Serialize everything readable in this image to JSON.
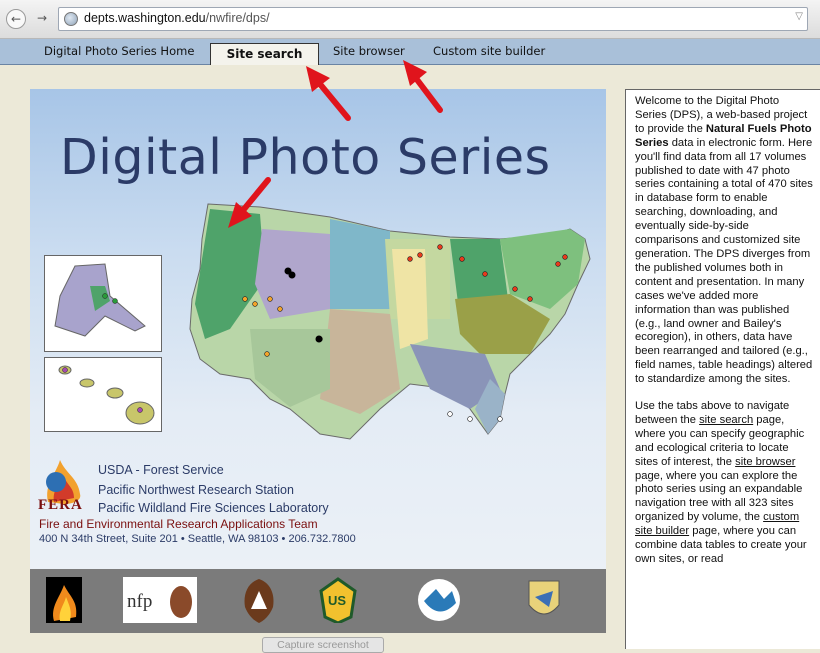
{
  "browser": {
    "url_host": "depts.washington.edu",
    "url_path": "/nwfire/dps/",
    "back_glyph": "←",
    "forward_glyph": "→"
  },
  "tabs": [
    {
      "label": "Digital Photo Series Home",
      "active": false
    },
    {
      "label": "Site search",
      "active": true
    },
    {
      "label": "Site browser",
      "active": false
    },
    {
      "label": "Custom site builder",
      "active": false
    }
  ],
  "banner": {
    "title": "Digital Photo Series",
    "agency": "USDA - Forest Service",
    "station": "Pacific Northwest Research Station",
    "lab": "Pacific Wildland Fire Sciences Laboratory",
    "fera_abbr": "FERA",
    "fera_team": "Fire and Environmental Research Applications Team",
    "address": "400 N 34th Street, Suite 201  •  Seattle, WA  98103  •  206.732.7800"
  },
  "logos": [
    {
      "name": "jfsp-logo",
      "text": "Joint Fire Science Program"
    },
    {
      "name": "nfp-logo",
      "text": "nfp"
    },
    {
      "name": "nps-logo",
      "text": "National Park Service"
    },
    {
      "name": "forest-service-logo",
      "text": "US"
    },
    {
      "name": "blm-logo",
      "text": "U.S. Department of the Interior Bureau of Land Management"
    },
    {
      "name": "fws-logo",
      "text": "Fish & Wildlife Service"
    }
  ],
  "sidebar": {
    "p1_a": "Welcome to the Digital Photo Series (DPS), a web-based project to provide the ",
    "p1_bold": "Natural Fuels Photo Series",
    "p1_b": " data in electronic form. Here you'll find data from all 17 volumes published to date with 47 photo series containing a total of 470 sites in database form to enable searching, downloading, and eventually side-by-side comparisons and customized site generation. The DPS diverges from the published volumes both in content and presentation. In many cases we've added more information than was published (e.g., land owner and Bailey's ecoregion), in others, data have been rearranged and tailored (e.g., field names, table headings) altered to standardize among the sites.",
    "p2_a": "Use the tabs above to navigate between the ",
    "p2_link1": "site search",
    "p2_b": " page, where you can specify geographic and ecological criteria to locate sites of interest, the ",
    "p2_link2": "site browser",
    "p2_c": " page, where you can explore the photo series using an expandable navigation tree with all 323 sites organized by volume, the ",
    "p2_link3": "custom site builder",
    "p2_d": " page, where you can combine data tables to create your own sites, or read"
  },
  "capture_label": "Capture screenshot",
  "colors": {
    "tab_strip": "#a9c0d9",
    "title": "#2b3b67",
    "arrow": "#e0141c",
    "fera_red": "#7a0f0f"
  }
}
